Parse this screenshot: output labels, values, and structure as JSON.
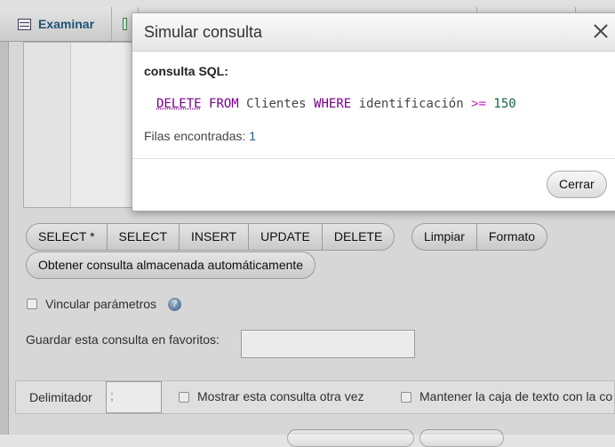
{
  "tabs": {
    "browse_label": "Examinar"
  },
  "query_buttons": [
    "SELECT *",
    "SELECT",
    "INSERT",
    "UPDATE",
    "DELETE"
  ],
  "tool_buttons": [
    "Limpiar",
    "Formato"
  ],
  "stored_query_button": "Obtener consulta almacenada automáticamente",
  "bind_params_label": "Vincular parámetros",
  "bind_params_checked": false,
  "help_icon": "help-icon",
  "favorites_label": "Guardar esta consulta en favoritos:",
  "favorites_value": "",
  "bottom": {
    "delimiter_label": "Delimitador",
    "delimiter_value": ";",
    "show_again_label": "Mostrar esta consulta otra vez",
    "keep_textbox_label": "Mantener la caja de texto con la co"
  },
  "dialog": {
    "title": "Simular consulta",
    "close_icon": "close-icon",
    "sql_label": "consulta SQL:",
    "sql": {
      "kw1": "DELETE",
      "kw2": "FROM",
      "table": "Clientes",
      "kw3": "WHERE",
      "column": "identificación",
      "operator": ">=",
      "value": "150"
    },
    "rows_label": "Filas encontradas:",
    "rows_value": "1",
    "close_button": "Cerrar"
  },
  "colors": {
    "accent": "#235a81",
    "sql_keyword": "#770088",
    "sql_operator": "#cc22cc",
    "sql_number": "#116644"
  }
}
